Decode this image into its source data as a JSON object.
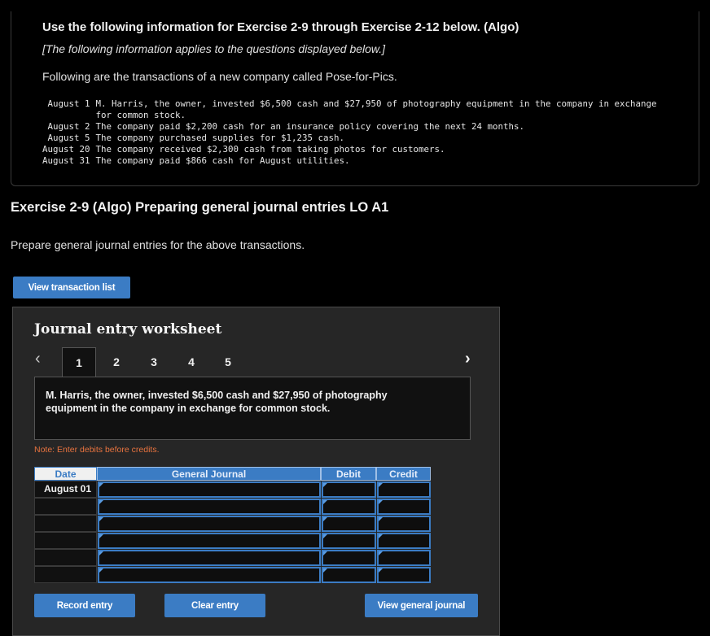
{
  "info": {
    "title": "Use the following information for Exercise 2-9 through Exercise 2-12 below. (Algo)",
    "subtitle": "[The following information applies to the questions displayed below.]",
    "intro": "Following are the transactions of a new company called Pose-for-Pics.",
    "transactions": [
      {
        "date": "August 1",
        "desc": "M. Harris, the owner, invested $6,500 cash and $27,950 of photography equipment in the company in exchange for common stock."
      },
      {
        "date": "August 2",
        "desc": "The company paid $2,200 cash for an insurance policy covering the next 24 months."
      },
      {
        "date": "August 5",
        "desc": "The company purchased supplies for $1,235 cash."
      },
      {
        "date": "August 20",
        "desc": "The company received $2,300 cash from taking photos for customers."
      },
      {
        "date": "August 31",
        "desc": "The company paid $866 cash for August utilities."
      }
    ]
  },
  "exercise": {
    "heading": "Exercise 2-9 (Algo) Preparing general journal entries LO A1",
    "instruction": "Prepare general journal entries for the above transactions.",
    "view_transaction_list_label": "View transaction list"
  },
  "worksheet": {
    "title": "Journal entry worksheet",
    "prev_icon": "chevron-left-icon",
    "next_icon": "chevron-right-icon",
    "tabs": [
      "1",
      "2",
      "3",
      "4",
      "5"
    ],
    "active_tab": "1",
    "description": "M. Harris, the owner, invested $6,500 cash and $27,950 of photography equipment in the company in exchange for common stock.",
    "note": "Note: Enter debits before credits.",
    "columns": {
      "date": "Date",
      "general_journal": "General Journal",
      "debit": "Debit",
      "credit": "Credit"
    },
    "rows": [
      {
        "date": "August 01",
        "account": "",
        "debit": "",
        "credit": ""
      },
      {
        "date": "",
        "account": "",
        "debit": "",
        "credit": ""
      },
      {
        "date": "",
        "account": "",
        "debit": "",
        "credit": ""
      },
      {
        "date": "",
        "account": "",
        "debit": "",
        "credit": ""
      },
      {
        "date": "",
        "account": "",
        "debit": "",
        "credit": ""
      },
      {
        "date": "",
        "account": "",
        "debit": "",
        "credit": ""
      }
    ],
    "buttons": {
      "record": "Record entry",
      "clear": "Clear entry",
      "view_general_journal": "View general journal"
    }
  },
  "colors": {
    "accent": "#3b7cc4",
    "note": "#e8733f",
    "background": "#000000",
    "panel": "#262626"
  }
}
